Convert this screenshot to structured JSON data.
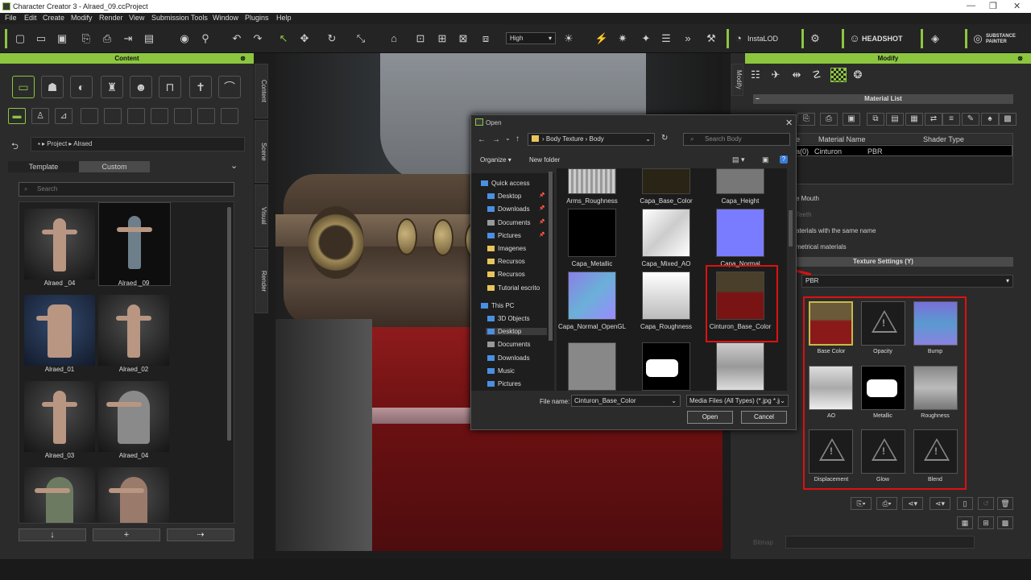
{
  "window": {
    "title": "Character Creator 3 - Alraed_09.ccProject",
    "minimize": "—",
    "restore": "❐",
    "close": "✕"
  },
  "menu": [
    "File",
    "Edit",
    "Create",
    "Modify",
    "Render",
    "View",
    "Submission Tools",
    "Window",
    "Plugins",
    "Help"
  ],
  "toolbar": {
    "quality": "High",
    "instalod": "InstaLOD",
    "headshot": "HEADSHOT",
    "substance": "SUBSTANCE PAINTER"
  },
  "content_panel": {
    "title": "Content",
    "breadcrumb": [
      "Project",
      "Alraed"
    ],
    "tabs": [
      "Template",
      "Custom"
    ],
    "active_tab": "Custom",
    "search_placeholder": "Search",
    "items": [
      "Alraed _04",
      "Alraed _09",
      "Alraed_01",
      "Alraed_02",
      "Alraed_03",
      "Alraed_04",
      "",
      ""
    ]
  },
  "side_tabs": [
    "Content",
    "Scene",
    "Visual",
    "Render"
  ],
  "dialog": {
    "title": "Open",
    "path": [
      "Body Texture",
      "Body"
    ],
    "search_placeholder": "Search Body",
    "organize": "Organize",
    "new_folder": "New folder",
    "nav": [
      {
        "label": "Quick access",
        "pinned": false
      },
      {
        "label": "Desktop",
        "pinned": true
      },
      {
        "label": "Downloads",
        "pinned": true
      },
      {
        "label": "Documents",
        "pinned": true
      },
      {
        "label": "Pictures",
        "pinned": true
      },
      {
        "label": "Imagenes",
        "pinned": false
      },
      {
        "label": "Recursos",
        "pinned": false
      },
      {
        "label": "Recursos",
        "pinned": false
      },
      {
        "label": "Tutorial escrito",
        "pinned": false
      },
      {
        "label": "This PC",
        "pinned": false
      },
      {
        "label": "3D Objects",
        "pinned": false
      },
      {
        "label": "Desktop",
        "pinned": false
      },
      {
        "label": "Documents",
        "pinned": false
      },
      {
        "label": "Downloads",
        "pinned": false
      },
      {
        "label": "Music",
        "pinned": false
      },
      {
        "label": "Pictures",
        "pinned": false
      }
    ],
    "files": [
      "Arms_Roughness",
      "Capa_Base_Color",
      "Capa_Height",
      "Capa_Metallic",
      "Capa_Mixed_AO",
      "Capa_Normal",
      "Capa_Normal_OpenGL",
      "Capa_Roughness",
      "Cinturon_Base_Color",
      "",
      "",
      ""
    ],
    "filename_label": "File name:",
    "filename_value": "Cinturon_Base_Color",
    "filetype": "Media Files (All Types) (*.jpg *.jp",
    "open": "Open",
    "cancel": "Cancel"
  },
  "modify_panel": {
    "title": "Modify",
    "side_tab": "Modify",
    "material_list_title": "Material List",
    "columns": [
      "e",
      "Material Name",
      "Shader Type"
    ],
    "row": [
      "a(0)",
      "Cinturon",
      "PBR"
    ],
    "options": [
      "e Mouth",
      "Teeth",
      "aterials with the same name",
      "metrical materials"
    ],
    "texture_settings_title": "Texture Settings  (Y)",
    "shader": "PBR",
    "textures": [
      "Base Color",
      "Opacity",
      "Bump",
      "AO",
      "Metallic",
      "Roughness",
      "Displacement",
      "Glow",
      "Blend"
    ],
    "bitmap_label": "Bitmap"
  }
}
